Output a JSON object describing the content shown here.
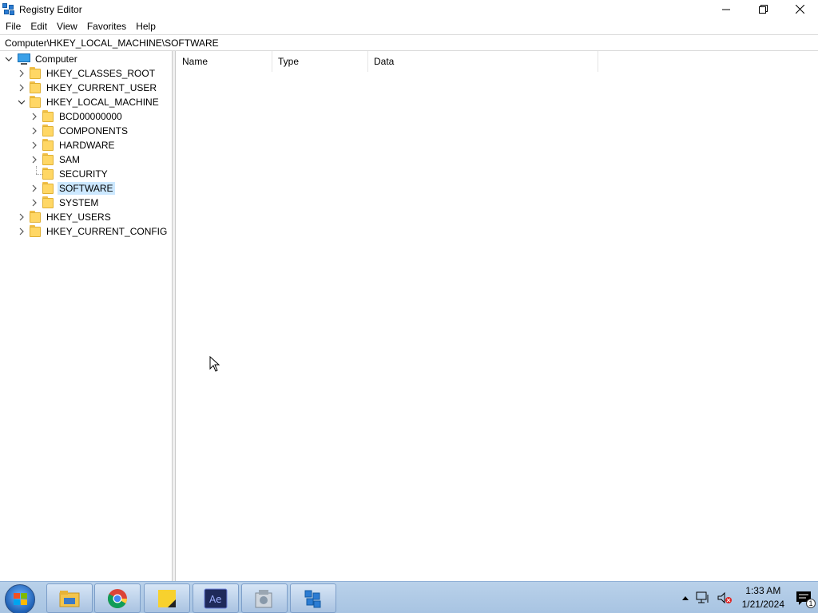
{
  "window": {
    "title": "Registry Editor",
    "controls": {
      "minimize": "minimize",
      "restore": "restore",
      "close": "close"
    }
  },
  "menu": {
    "items": [
      "File",
      "Edit",
      "View",
      "Favorites",
      "Help"
    ]
  },
  "address": {
    "path": "Computer\\HKEY_LOCAL_MACHINE\\SOFTWARE"
  },
  "tree": {
    "root": "Computer",
    "hives": [
      "HKEY_CLASSES_ROOT",
      "HKEY_CURRENT_USER",
      "HKEY_LOCAL_MACHINE",
      "HKEY_USERS",
      "HKEY_CURRENT_CONFIG"
    ],
    "hklm_children": [
      "BCD00000000",
      "COMPONENTS",
      "HARDWARE",
      "SAM",
      "SECURITY",
      "SOFTWARE",
      "SYSTEM"
    ],
    "selected": "SOFTWARE"
  },
  "list": {
    "columns": [
      "Name",
      "Type",
      "Data"
    ]
  },
  "taskbar": {
    "apps": [
      "file-explorer",
      "chrome",
      "sticky-notes",
      "adobe-app",
      "utility-app",
      "registry-editor"
    ],
    "time": "1:33 AM",
    "date": "1/21/2024",
    "notification_count": "1"
  },
  "colors": {
    "selection": "#cce8ff",
    "folder": "#ffd765",
    "taskbar": "#b9d1ea"
  }
}
